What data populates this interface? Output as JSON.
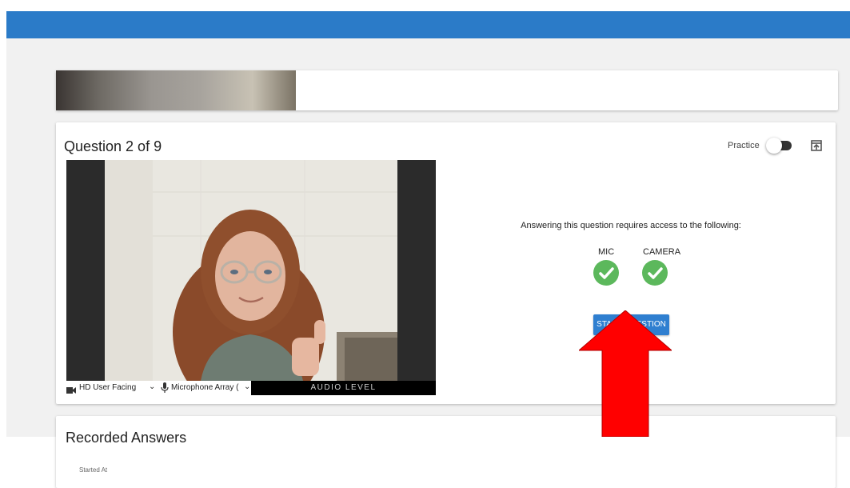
{
  "question_card": {
    "title": "Question 2 of 9",
    "practice_label": "Practice",
    "practice_toggle": "off"
  },
  "video": {
    "camera_select": "HD User Facing",
    "microphone_select": "Microphone Array (",
    "audio_level_label": "AUDIO LEVEL"
  },
  "permissions": {
    "requires_text": "Answering this question requires access to the following:",
    "mic_label": "MIC",
    "camera_label": "CAMERA"
  },
  "start_button_label": "START QUESTION",
  "recorded_answers": {
    "title": "Recorded Answers",
    "started_at_label": "Started At"
  },
  "colors": {
    "header_blue": "#2b7bc8",
    "button_blue": "#2f7fd0",
    "check_green": "#5cb85c",
    "arrow_red": "#ff0000"
  },
  "icons": [
    "camera-icon",
    "microphone-icon",
    "export-icon",
    "check-icon",
    "chevron-down-icon"
  ]
}
